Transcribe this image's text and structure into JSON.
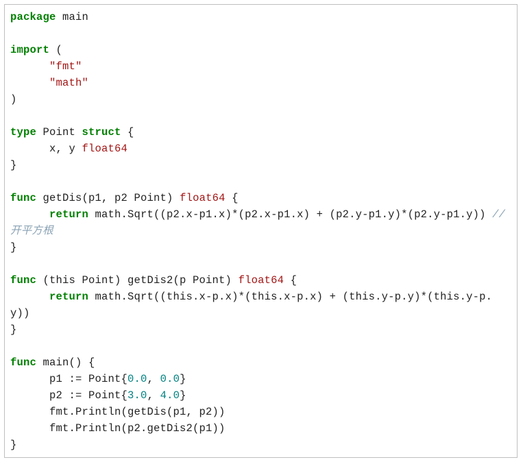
{
  "code": {
    "l1_kw_package": "package",
    "l1_ident_main": " main",
    "l3_kw_import": "import",
    "l3_paren_open": " (",
    "l4_indent": "      ",
    "l4_str_fmt": "\"fmt\"",
    "l5_indent": "      ",
    "l5_str_math": "\"math\"",
    "l6_paren_close": ")",
    "l8_kw_type": "type",
    "l8_ident_point": " Point ",
    "l8_kw_struct": "struct",
    "l8_brace_open": " {",
    "l9_indent": "      ",
    "l9_ident_xy": "x, y ",
    "l9_type_float64": "float64",
    "l10_brace_close": "}",
    "l12_kw_func": "func",
    "l12_ident_getdis": " getDis(p1, p2 Point) ",
    "l12_type_float64": "float64",
    "l12_brace_open": " {",
    "l13_indent": "      ",
    "l13_kw_return": "return",
    "l13_expr": " math.Sqrt((p2.x-p1.x)*(p2.x-p1.x) + (p2.y-p1.y)*(p2.y-p1.y)) ",
    "l13_comment": "//开平方根",
    "l15_brace_close": "}",
    "l17_kw_func": "func",
    "l17_ident_recv": " (this Point) getDis2(p Point) ",
    "l17_type_float64": "float64",
    "l17_brace_open": " {",
    "l18_indent": "      ",
    "l18_kw_return": "return",
    "l18_expr": " math.Sqrt((this.x-p.x)*(this.x-p.x) + (this.y-p.y)*(this.y-p.y))",
    "l20_brace_close": "}",
    "l22_kw_func": "func",
    "l22_ident_main": " main() {",
    "l23_indent": "      ",
    "l23_ident_p1": "p1 := Point{",
    "l23_num_a": "0.0",
    "l23_comma": ", ",
    "l23_num_b": "0.0",
    "l23_brace_close": "}",
    "l24_indent": "      ",
    "l24_ident_p2": "p2 := Point{",
    "l24_num_a": "3.0",
    "l24_comma": ", ",
    "l24_num_b": "4.0",
    "l24_brace_close": "}",
    "l25_indent": "      ",
    "l25_call1": "fmt.Println(getDis(p1, p2))",
    "l26_indent": "      ",
    "l26_call2": "fmt.Println(p2.getDis2(p1))",
    "l27_brace_close": "}"
  }
}
